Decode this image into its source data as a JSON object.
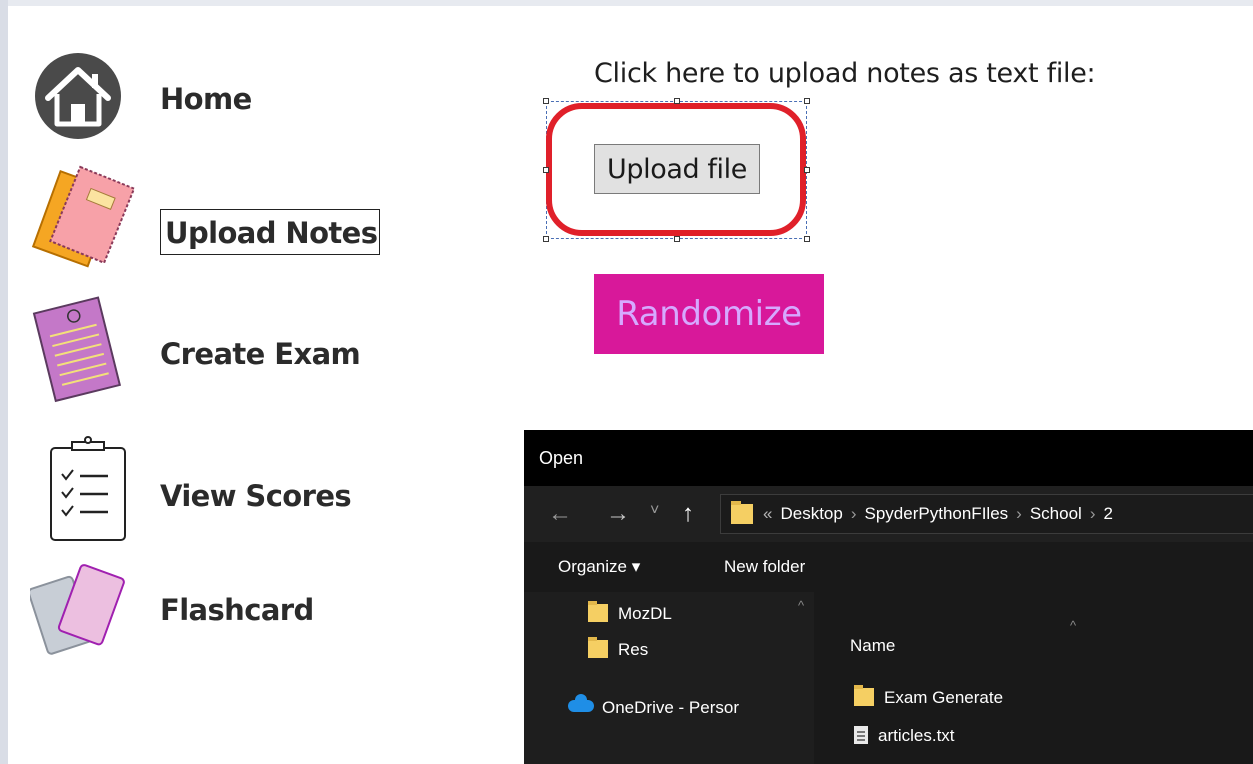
{
  "sidebar": {
    "items": [
      {
        "label": "Home",
        "icon": "home-icon"
      },
      {
        "label": "Upload Notes",
        "icon": "notebooks-icon"
      },
      {
        "label": "Create Exam",
        "icon": "notebook-icon"
      },
      {
        "label": "View Scores",
        "icon": "clipboard-checklist-icon"
      },
      {
        "label": "Flashcard",
        "icon": "flashcards-icon"
      }
    ]
  },
  "main": {
    "prompt": "Click here to upload notes as text file:",
    "upload_button": "Upload file",
    "randomize_button": "Randomize"
  },
  "colors": {
    "randomize_bg": "#d8189a",
    "randomize_text": "#d6a9ff",
    "highlight": "#e0202a"
  },
  "dialog": {
    "title": "Open",
    "nav": {
      "back": "←",
      "forward": "→",
      "recent": "˅",
      "up": "↑"
    },
    "address": {
      "overflow": "«",
      "crumbs": [
        "Desktop",
        "SpyderPythonFIles",
        "School",
        "2"
      ]
    },
    "toolbar": {
      "organize": "Organize ▾",
      "new_folder": "New folder"
    },
    "sidebar": [
      {
        "label": "MozDL",
        "icon": "folder-icon"
      },
      {
        "label": "Res",
        "icon": "folder-icon"
      },
      {
        "label": "OneDrive - Persor",
        "icon": "onedrive-icon"
      }
    ],
    "column_header": "Name",
    "files": [
      {
        "label": "Exam Generate",
        "icon": "folder-icon"
      },
      {
        "label": "articles.txt",
        "icon": "text-file-icon"
      }
    ]
  }
}
